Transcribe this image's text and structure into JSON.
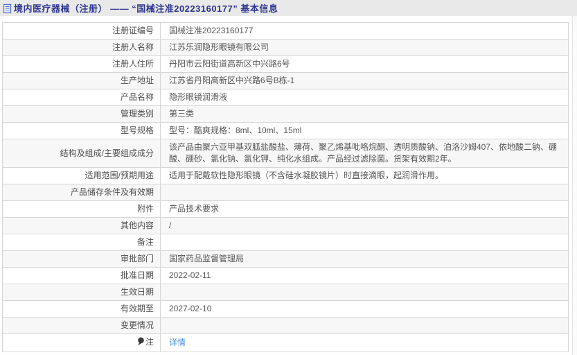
{
  "header": {
    "title": "境内医疗器械（注册） ——  “国械注准20223160177” 基本信息",
    "icon": "document-icon",
    "title_color": "#2e3590",
    "bar_color": "#e9e9e9"
  },
  "colors": {
    "link": "#4a90e2",
    "row_alt": "#f7f7f7",
    "border": "#d6d6d6",
    "text": "#555555"
  },
  "table": {
    "rows": [
      {
        "label": "注册证编号",
        "value": "国械注准20223160177"
      },
      {
        "label": "注册人名称",
        "value": "江苏乐润隐形眼镜有限公司"
      },
      {
        "label": "注册人住所",
        "value": "丹阳市云阳街道高新区中兴路6号"
      },
      {
        "label": "生产地址",
        "value": "江苏省丹阳高新区中兴路6号B栋-1"
      },
      {
        "label": "产品名称",
        "value": "隐形眼镜润滑液"
      },
      {
        "label": "管理类别",
        "value": "第三类"
      },
      {
        "label": "型号规格",
        "value": "型号：酷爽规格：8ml、10ml、15ml"
      },
      {
        "label": "结构及组成/主要组成成分",
        "value": "该产品由聚六亚甲基双胍盐酸盐、薄荷、聚乙烯基吡咯烷酮、透明质酸钠、泊洛沙姆407、依地酸二钠、硼酸、硼砂、氯化钠、氯化钾、纯化水组成。产品经过滤除菌。货架有效期2年。"
      },
      {
        "label": "适用范围/预期用途",
        "value": "适用于配戴软性隐形眼镜（不含硅水凝胶镜片）时直接滴眼，起润滑作用。"
      },
      {
        "label": "产品储存条件及有效期",
        "value": ""
      },
      {
        "label": "附件",
        "value": "产品技术要求"
      },
      {
        "label": "其他内容",
        "value": "/"
      },
      {
        "label": "备注",
        "value": ""
      },
      {
        "label": "审批部门",
        "value": "国家药品监督管理局"
      },
      {
        "label": "批准日期",
        "value": "2022-02-11"
      },
      {
        "label": "生效日期",
        "value": ""
      },
      {
        "label": "有效期至",
        "value": "2027-02-10"
      },
      {
        "label": "变更情况",
        "value": ""
      },
      {
        "label": "注",
        "value": "详情",
        "value_is_link": true,
        "icon": "pin-icon"
      }
    ]
  }
}
